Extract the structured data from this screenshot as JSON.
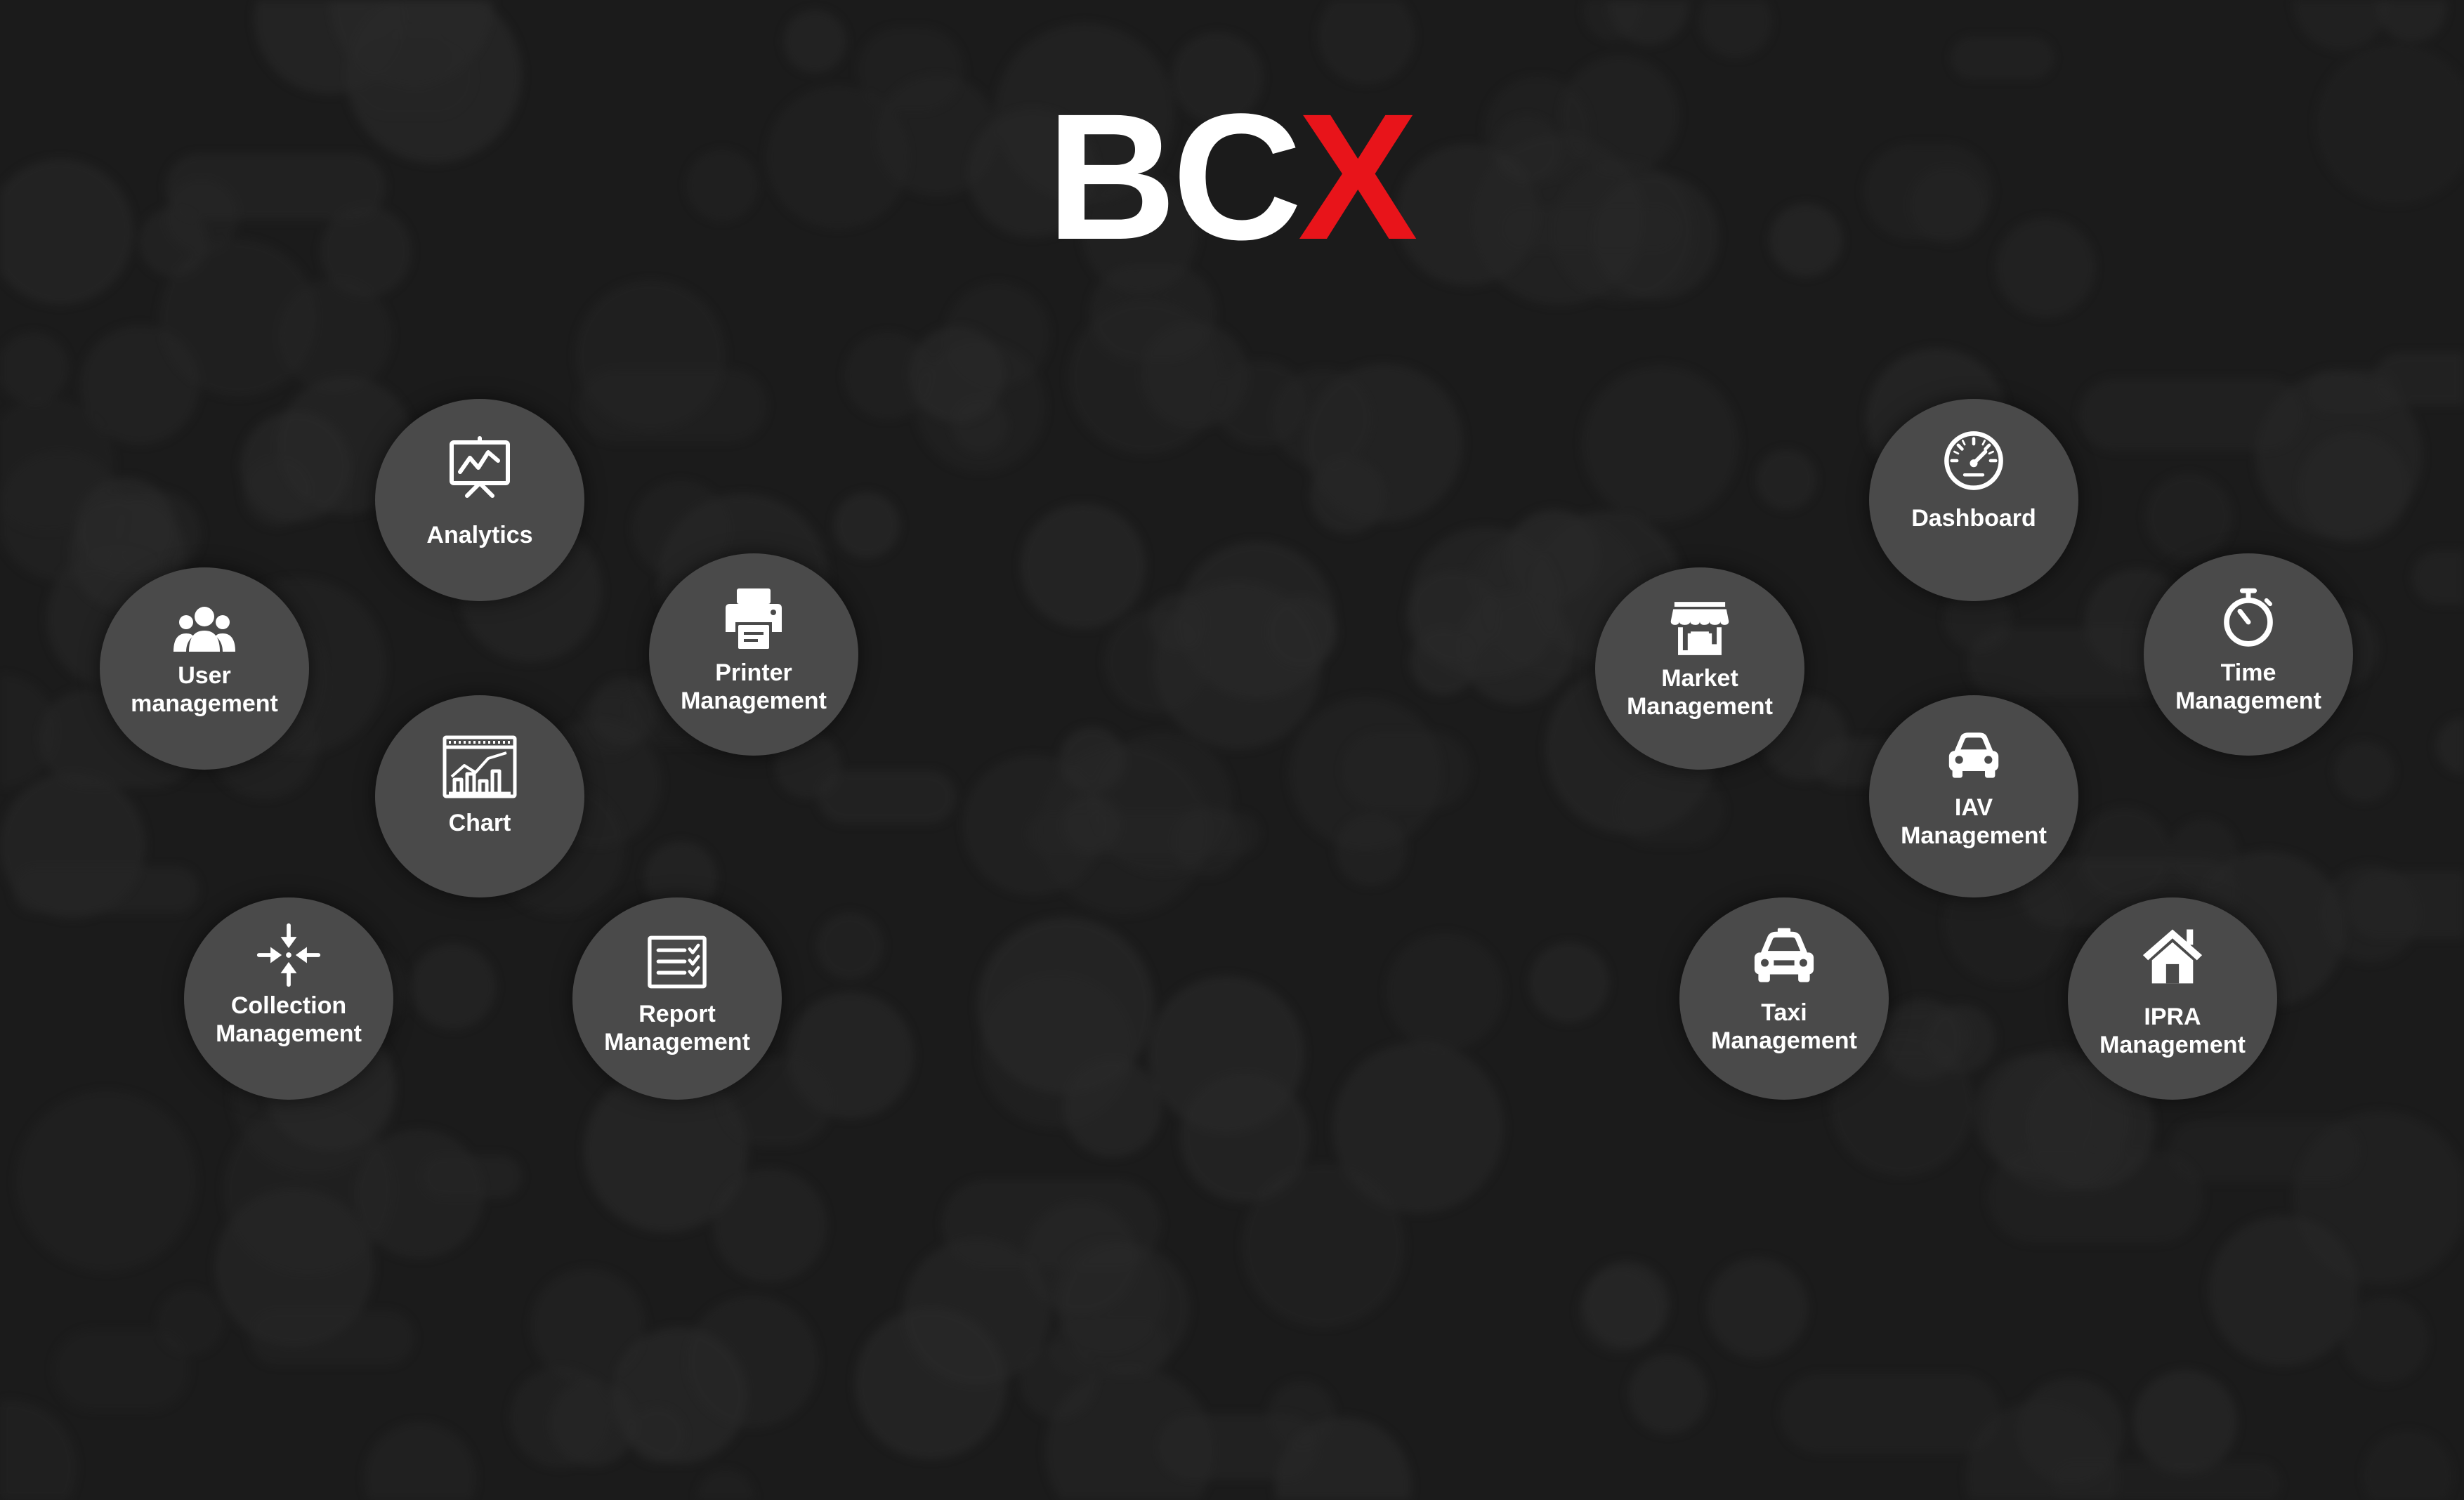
{
  "brand": {
    "text_primary": "BC",
    "text_accent": "X",
    "primary_color": "#ffffff",
    "accent_color": "#e8141a"
  },
  "background_color": "#1b1b1b",
  "tile_color": "#4a4a4a",
  "left_group": {
    "analytics": {
      "label": "Analytics",
      "icon": "analytics-icon"
    },
    "user_management": {
      "line1": "User",
      "line2": "management",
      "icon": "users-icon"
    },
    "printer_management": {
      "line1": "Printer",
      "line2": "Management",
      "icon": "printer-icon"
    },
    "chart": {
      "label": "Chart",
      "icon": "chart-icon"
    },
    "collection_management": {
      "line1": "Collection",
      "line2": "Management",
      "icon": "collection-icon"
    },
    "report_management": {
      "line1": "Report",
      "line2": "Management",
      "icon": "report-icon"
    }
  },
  "right_group": {
    "dashboard": {
      "label": "Dashboard",
      "icon": "speedometer-icon"
    },
    "market_management": {
      "line1": "Market",
      "line2": "Management",
      "icon": "store-icon"
    },
    "time_management": {
      "line1": "Time",
      "line2": "Management",
      "icon": "stopwatch-icon"
    },
    "iav_management": {
      "line1": "IAV",
      "line2": "Management",
      "icon": "car-icon"
    },
    "taxi_management": {
      "line1": "Taxi",
      "line2": "Management",
      "icon": "taxi-icon"
    },
    "ipra_management": {
      "line1": "IPRA",
      "line2": "Management",
      "icon": "home-icon"
    }
  }
}
